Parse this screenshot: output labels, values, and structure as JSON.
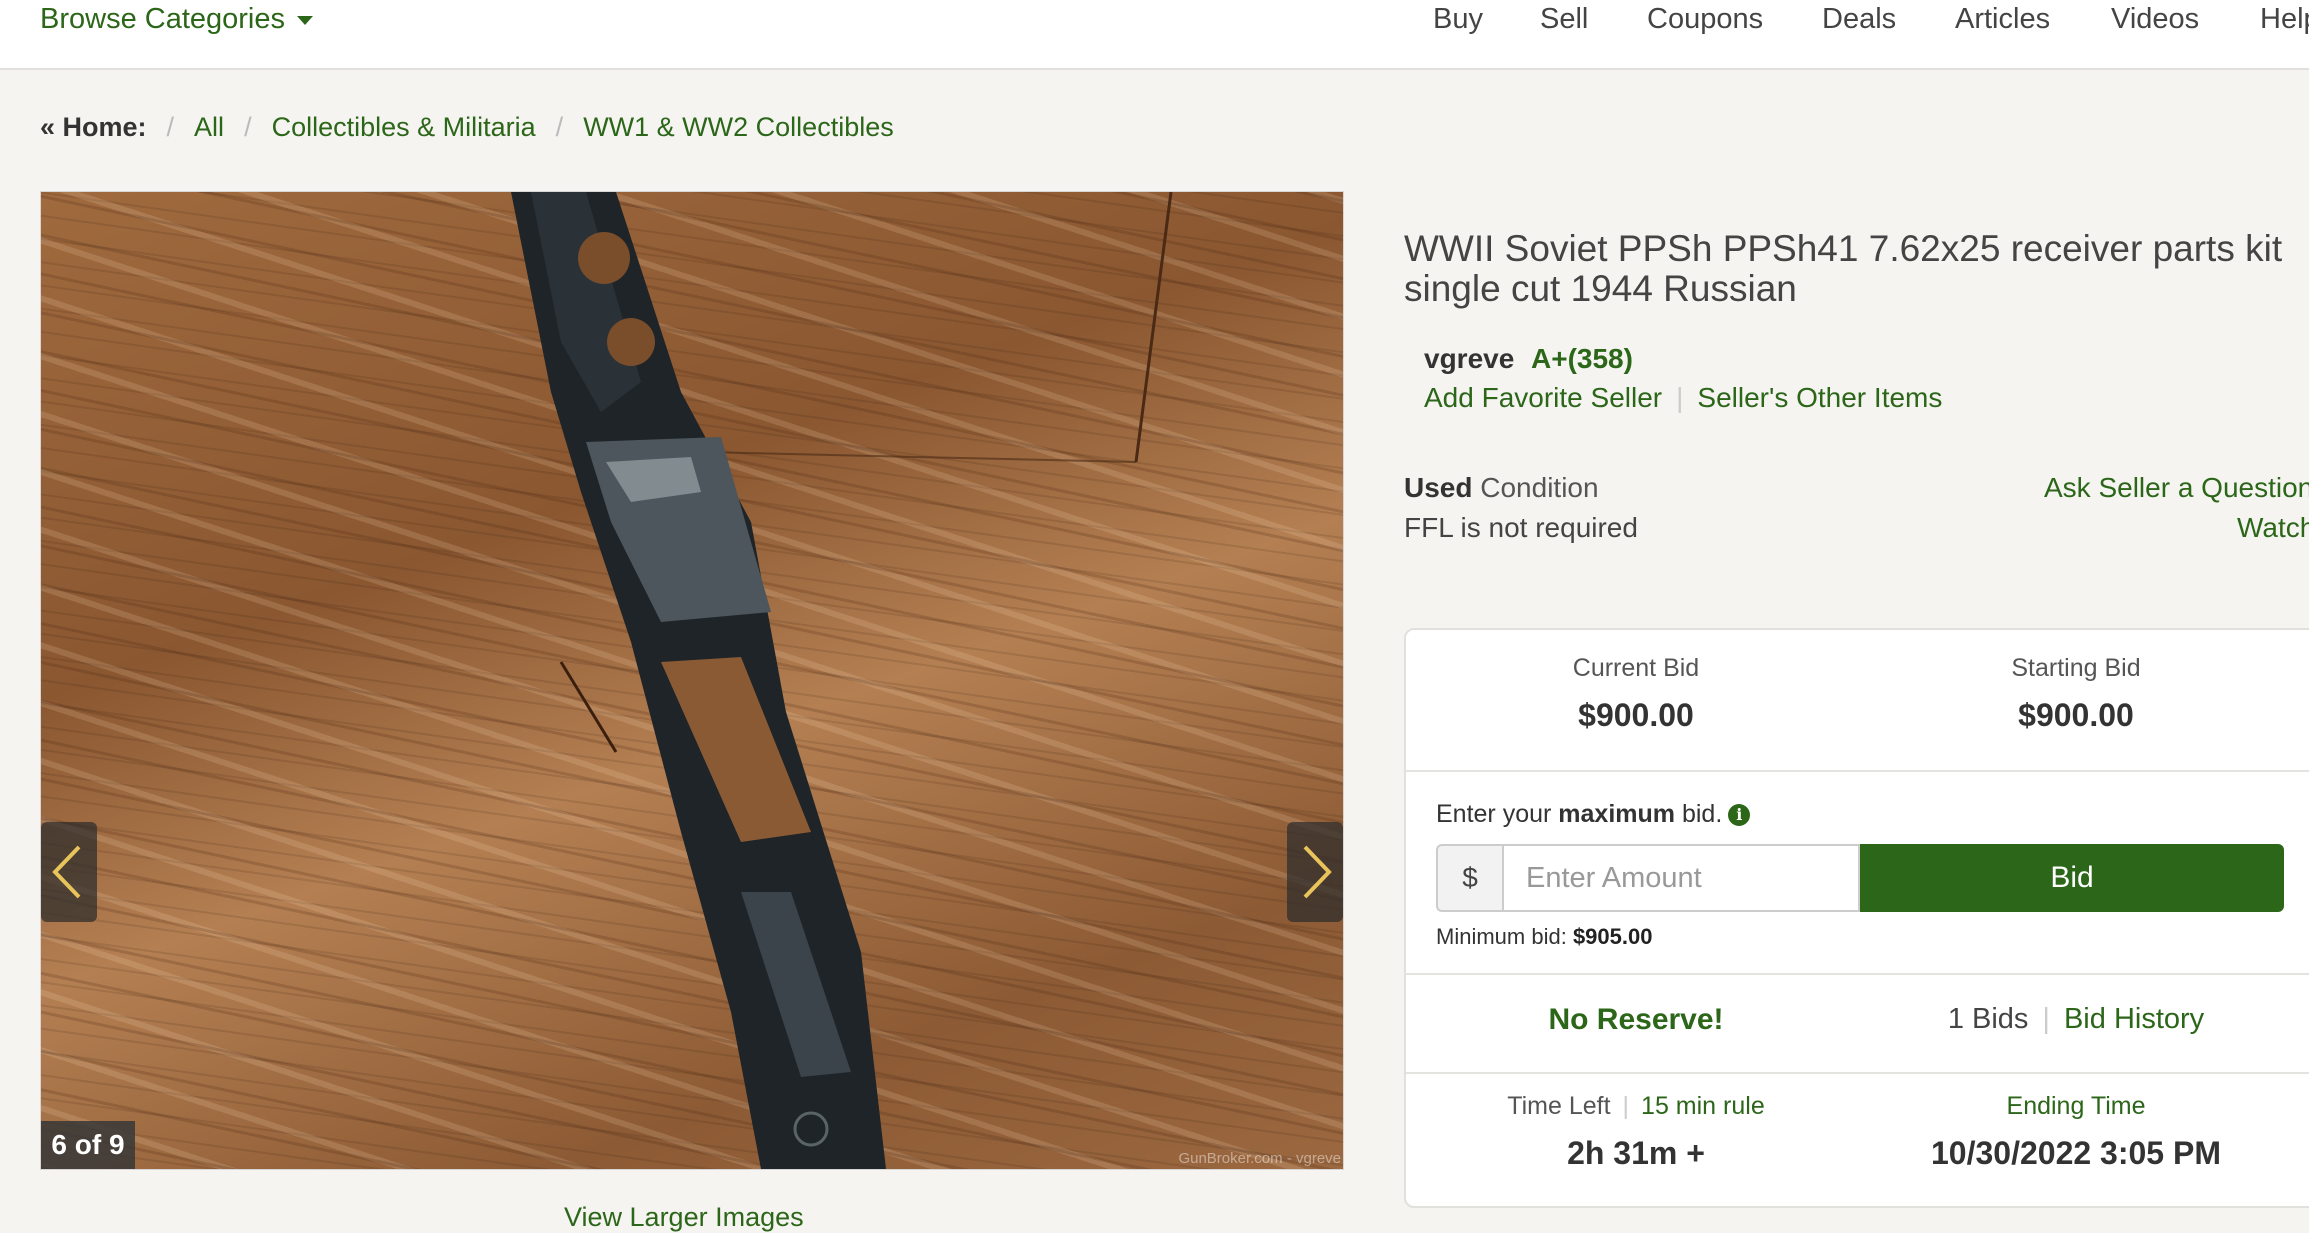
{
  "header": {
    "browse_label": "Browse Categories",
    "nav": [
      "Buy",
      "Sell",
      "Coupons",
      "Deals",
      "Articles",
      "Videos",
      "Help"
    ]
  },
  "breadcrumb": {
    "home": "« Home:",
    "items": [
      "All",
      "Collectibles & Militaria",
      "WW1 & WW2 Collectibles"
    ]
  },
  "gallery": {
    "counter": "6 of 9",
    "watermark": "GunBroker.com - vgreve",
    "view_larger": "View Larger Images"
  },
  "listing": {
    "title": "WWII Soviet PPSh PPSh41 7.62x25 receiver parts kit single cut 1944 Russian",
    "seller_name": "vgreve",
    "seller_rating": "A+(358)",
    "add_favorite": "Add Favorite Seller",
    "other_items": "Seller's Other Items",
    "condition_bold": "Used",
    "condition_label": "Condition",
    "ffl": "FFL is not required",
    "ask_seller": "Ask Seller a Question",
    "watch": "Watch"
  },
  "bid": {
    "current_label": "Current Bid",
    "current_value": "$900.00",
    "starting_label": "Starting Bid",
    "starting_value": "$900.00",
    "enter_prefix": "Enter your",
    "enter_bold": "maximum",
    "enter_suffix": "bid.",
    "currency_symbol": "$",
    "amount_placeholder": "Enter Amount",
    "bid_button": "Bid",
    "min_label": "Minimum bid:",
    "min_value": "$905.00",
    "no_reserve": "No Reserve!",
    "bids_count": "1 Bids",
    "bid_history": "Bid History",
    "time_left_label": "Time Left",
    "rule": "15 min rule",
    "time_left_value": "2h 31m +",
    "ending_label": "Ending Time",
    "ending_value": "10/30/2022 3:05 PM"
  },
  "colors": {
    "brand_green": "#2c6619",
    "background": "#f5f4f1"
  }
}
